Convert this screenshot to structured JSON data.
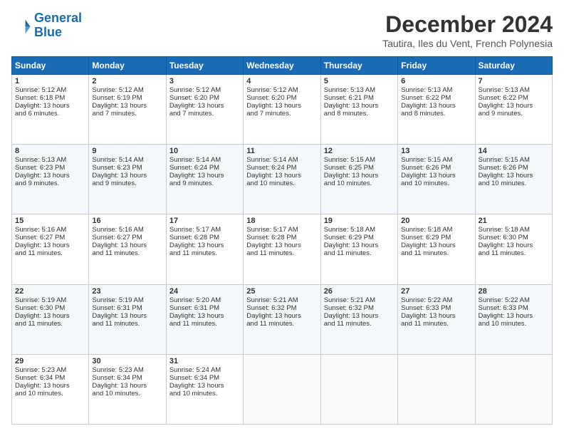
{
  "logo": {
    "line1": "General",
    "line2": "Blue"
  },
  "title": "December 2024",
  "subtitle": "Tautira, Iles du Vent, French Polynesia",
  "days_header": [
    "Sunday",
    "Monday",
    "Tuesday",
    "Wednesday",
    "Thursday",
    "Friday",
    "Saturday"
  ],
  "weeks": [
    [
      {
        "day": "1",
        "lines": [
          "Sunrise: 5:12 AM",
          "Sunset: 6:18 PM",
          "Daylight: 13 hours",
          "and 6 minutes."
        ]
      },
      {
        "day": "2",
        "lines": [
          "Sunrise: 5:12 AM",
          "Sunset: 6:19 PM",
          "Daylight: 13 hours",
          "and 7 minutes."
        ]
      },
      {
        "day": "3",
        "lines": [
          "Sunrise: 5:12 AM",
          "Sunset: 6:20 PM",
          "Daylight: 13 hours",
          "and 7 minutes."
        ]
      },
      {
        "day": "4",
        "lines": [
          "Sunrise: 5:12 AM",
          "Sunset: 6:20 PM",
          "Daylight: 13 hours",
          "and 7 minutes."
        ]
      },
      {
        "day": "5",
        "lines": [
          "Sunrise: 5:13 AM",
          "Sunset: 6:21 PM",
          "Daylight: 13 hours",
          "and 8 minutes."
        ]
      },
      {
        "day": "6",
        "lines": [
          "Sunrise: 5:13 AM",
          "Sunset: 6:22 PM",
          "Daylight: 13 hours",
          "and 8 minutes."
        ]
      },
      {
        "day": "7",
        "lines": [
          "Sunrise: 5:13 AM",
          "Sunset: 6:22 PM",
          "Daylight: 13 hours",
          "and 9 minutes."
        ]
      }
    ],
    [
      {
        "day": "8",
        "lines": [
          "Sunrise: 5:13 AM",
          "Sunset: 6:23 PM",
          "Daylight: 13 hours",
          "and 9 minutes."
        ]
      },
      {
        "day": "9",
        "lines": [
          "Sunrise: 5:14 AM",
          "Sunset: 6:23 PM",
          "Daylight: 13 hours",
          "and 9 minutes."
        ]
      },
      {
        "day": "10",
        "lines": [
          "Sunrise: 5:14 AM",
          "Sunset: 6:24 PM",
          "Daylight: 13 hours",
          "and 9 minutes."
        ]
      },
      {
        "day": "11",
        "lines": [
          "Sunrise: 5:14 AM",
          "Sunset: 6:24 PM",
          "Daylight: 13 hours",
          "and 10 minutes."
        ]
      },
      {
        "day": "12",
        "lines": [
          "Sunrise: 5:15 AM",
          "Sunset: 6:25 PM",
          "Daylight: 13 hours",
          "and 10 minutes."
        ]
      },
      {
        "day": "13",
        "lines": [
          "Sunrise: 5:15 AM",
          "Sunset: 6:26 PM",
          "Daylight: 13 hours",
          "and 10 minutes."
        ]
      },
      {
        "day": "14",
        "lines": [
          "Sunrise: 5:15 AM",
          "Sunset: 6:26 PM",
          "Daylight: 13 hours",
          "and 10 minutes."
        ]
      }
    ],
    [
      {
        "day": "15",
        "lines": [
          "Sunrise: 5:16 AM",
          "Sunset: 6:27 PM",
          "Daylight: 13 hours",
          "and 11 minutes."
        ]
      },
      {
        "day": "16",
        "lines": [
          "Sunrise: 5:16 AM",
          "Sunset: 6:27 PM",
          "Daylight: 13 hours",
          "and 11 minutes."
        ]
      },
      {
        "day": "17",
        "lines": [
          "Sunrise: 5:17 AM",
          "Sunset: 6:28 PM",
          "Daylight: 13 hours",
          "and 11 minutes."
        ]
      },
      {
        "day": "18",
        "lines": [
          "Sunrise: 5:17 AM",
          "Sunset: 6:28 PM",
          "Daylight: 13 hours",
          "and 11 minutes."
        ]
      },
      {
        "day": "19",
        "lines": [
          "Sunrise: 5:18 AM",
          "Sunset: 6:29 PM",
          "Daylight: 13 hours",
          "and 11 minutes."
        ]
      },
      {
        "day": "20",
        "lines": [
          "Sunrise: 5:18 AM",
          "Sunset: 6:29 PM",
          "Daylight: 13 hours",
          "and 11 minutes."
        ]
      },
      {
        "day": "21",
        "lines": [
          "Sunrise: 5:18 AM",
          "Sunset: 6:30 PM",
          "Daylight: 13 hours",
          "and 11 minutes."
        ]
      }
    ],
    [
      {
        "day": "22",
        "lines": [
          "Sunrise: 5:19 AM",
          "Sunset: 6:30 PM",
          "Daylight: 13 hours",
          "and 11 minutes."
        ]
      },
      {
        "day": "23",
        "lines": [
          "Sunrise: 5:19 AM",
          "Sunset: 6:31 PM",
          "Daylight: 13 hours",
          "and 11 minutes."
        ]
      },
      {
        "day": "24",
        "lines": [
          "Sunrise: 5:20 AM",
          "Sunset: 6:31 PM",
          "Daylight: 13 hours",
          "and 11 minutes."
        ]
      },
      {
        "day": "25",
        "lines": [
          "Sunrise: 5:21 AM",
          "Sunset: 6:32 PM",
          "Daylight: 13 hours",
          "and 11 minutes."
        ]
      },
      {
        "day": "26",
        "lines": [
          "Sunrise: 5:21 AM",
          "Sunset: 6:32 PM",
          "Daylight: 13 hours",
          "and 11 minutes."
        ]
      },
      {
        "day": "27",
        "lines": [
          "Sunrise: 5:22 AM",
          "Sunset: 6:33 PM",
          "Daylight: 13 hours",
          "and 11 minutes."
        ]
      },
      {
        "day": "28",
        "lines": [
          "Sunrise: 5:22 AM",
          "Sunset: 6:33 PM",
          "Daylight: 13 hours",
          "and 10 minutes."
        ]
      }
    ],
    [
      {
        "day": "29",
        "lines": [
          "Sunrise: 5:23 AM",
          "Sunset: 6:34 PM",
          "Daylight: 13 hours",
          "and 10 minutes."
        ]
      },
      {
        "day": "30",
        "lines": [
          "Sunrise: 5:23 AM",
          "Sunset: 6:34 PM",
          "Daylight: 13 hours",
          "and 10 minutes."
        ]
      },
      {
        "day": "31",
        "lines": [
          "Sunrise: 5:24 AM",
          "Sunset: 6:34 PM",
          "Daylight: 13 hours",
          "and 10 minutes."
        ]
      },
      null,
      null,
      null,
      null
    ]
  ]
}
